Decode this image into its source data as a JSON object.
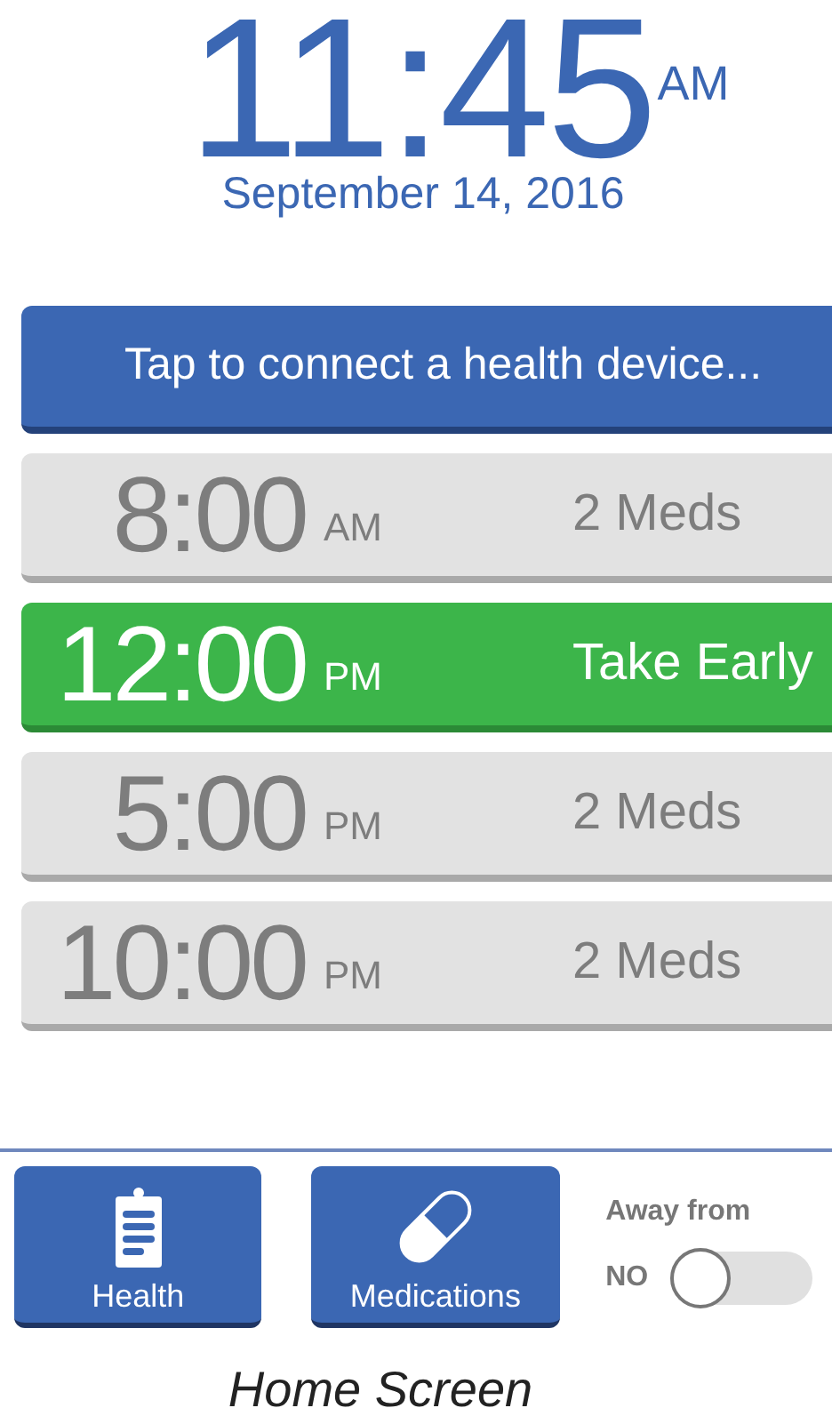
{
  "clock": {
    "time": "11:45",
    "meridiem": "AM",
    "date": "September 14, 2016"
  },
  "connect_button": {
    "label": "Tap to connect a health device..."
  },
  "schedule": [
    {
      "time": "8:00",
      "meridiem": "AM",
      "status": "2 Meds",
      "current": false
    },
    {
      "time": "12:00",
      "meridiem": "PM",
      "status": "Take Early",
      "current": true
    },
    {
      "time": "5:00",
      "meridiem": "PM",
      "status": "2 Meds",
      "current": false
    },
    {
      "time": "10:00",
      "meridiem": "PM",
      "status": "2 Meds",
      "current": false
    }
  ],
  "bottom_bar": {
    "buttons": [
      {
        "kind": "health",
        "label": "Health"
      },
      {
        "kind": "medications",
        "label": "Medications"
      }
    ],
    "away": {
      "label": "Away from",
      "state_label": "NO",
      "on": false
    }
  },
  "caption": "Home Screen"
}
